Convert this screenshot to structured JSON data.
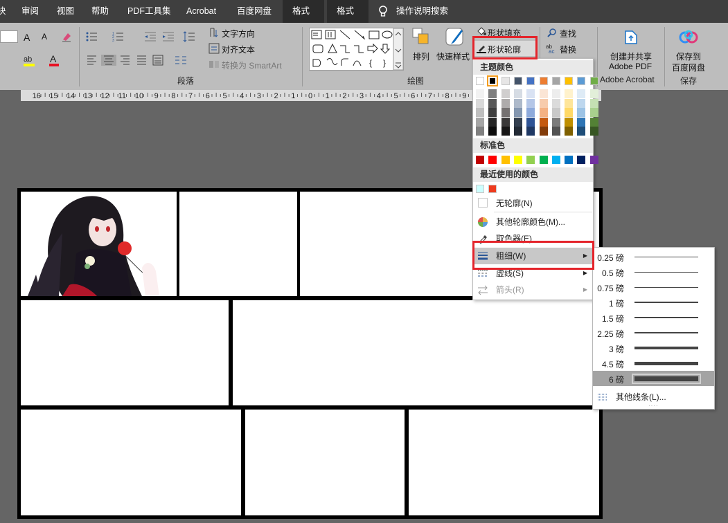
{
  "tabs": [
    "块",
    "审阅",
    "视图",
    "帮助",
    "PDF工具集",
    "Acrobat",
    "百度网盘",
    "格式",
    "格式"
  ],
  "search_tab": "操作说明搜索",
  "ribbon": {
    "font_size_a_up": "A",
    "text_direction": "文字方向",
    "align_text": "对齐文本",
    "convert_smartart": "转换为 SmartArt",
    "paragraph_label": "段落",
    "drawing_label": "绘图",
    "arrange": "排列",
    "quick_styles": "快速样式",
    "shape_fill": "形状填充",
    "shape_outline": "形状轮廓",
    "find": "查找",
    "replace": "替换",
    "create_share_line1": "创建并共享",
    "create_share_line2": "Adobe PDF",
    "adobe_acrobat_label": "Adobe Acrobat",
    "save_to_line1": "保存到",
    "save_to_line2": "百度网盘",
    "save_label": "保存",
    "shape_glyphs": [
      "{",
      "}"
    ]
  },
  "ruler": {
    "ticks": [
      "16",
      "15",
      "14",
      "13",
      "12",
      "11",
      "10",
      "9",
      "8",
      "7",
      "6",
      "5",
      "4",
      "3",
      "2",
      "1",
      "",
      "1",
      "2",
      "3",
      "4",
      "5",
      "6",
      "7",
      "8",
      "9"
    ],
    "zero": "0"
  },
  "outline_menu": {
    "theme_colors_title": "主题颜色",
    "standard_colors_title": "标准色",
    "recent_colors_title": "最近使用的颜色",
    "no_outline": "无轮廓(N)",
    "more_colors": "其他轮廓颜色(M)...",
    "eyedropper": "取色器(E)",
    "weight": "粗细(W)",
    "dashes": "虚线(S)",
    "arrows": "箭头(R)",
    "theme_top_row": [
      "#ffffff",
      "#000000",
      "#e7e6e6",
      "#44546a",
      "#4472c4",
      "#ed7d31",
      "#a5a5a5",
      "#ffc000",
      "#5b9bd5",
      "#70ad47"
    ],
    "theme_shades": [
      [
        "#f2f2f2",
        "#d9d9d9",
        "#bfbfbf",
        "#a6a6a6",
        "#808080"
      ],
      [
        "#7f7f7f",
        "#595959",
        "#3f3f3f",
        "#262626",
        "#0d0d0d"
      ],
      [
        "#d0cece",
        "#aeabab",
        "#757171",
        "#3a3838",
        "#171616"
      ],
      [
        "#d6dce4",
        "#adb9ca",
        "#8497b0",
        "#333f4f",
        "#222a35"
      ],
      [
        "#d9e2f3",
        "#b4c6e7",
        "#8eaadb",
        "#2f5496",
        "#1f3864"
      ],
      [
        "#fbe5d5",
        "#f7cbac",
        "#f4b183",
        "#c55a11",
        "#833c0b"
      ],
      [
        "#ededed",
        "#dbdbdb",
        "#c9c9c9",
        "#7b7b7b",
        "#525252"
      ],
      [
        "#fff2cc",
        "#fee599",
        "#ffd966",
        "#bf8f00",
        "#7f6000"
      ],
      [
        "#deebf6",
        "#bdd7ee",
        "#9cc3e5",
        "#2e75b5",
        "#1e4e79"
      ],
      [
        "#e2efd9",
        "#c5e0b3",
        "#a8d08d",
        "#538135",
        "#375623"
      ]
    ],
    "standard_colors": [
      "#c00000",
      "#ff0000",
      "#ffc000",
      "#ffff00",
      "#92d050",
      "#00b050",
      "#00b0f0",
      "#0070c0",
      "#002060",
      "#7030a0"
    ],
    "recent_colors": [
      "#ccffff",
      "#ee3b1e"
    ]
  },
  "weight_menu": {
    "items": [
      "0.25 磅",
      "0.5 磅",
      "0.75 磅",
      "1 磅",
      "1.5 磅",
      "2.25 磅",
      "3 磅",
      "4.5 磅",
      "6 磅"
    ],
    "more_lines": "其他线条(L)...",
    "selected_index": 8
  },
  "colors": {
    "highlight_red": "#e4242b",
    "tab_bar": "#3f3f3f",
    "ribbon": "#bdbdbd",
    "canvas": "#656565"
  }
}
